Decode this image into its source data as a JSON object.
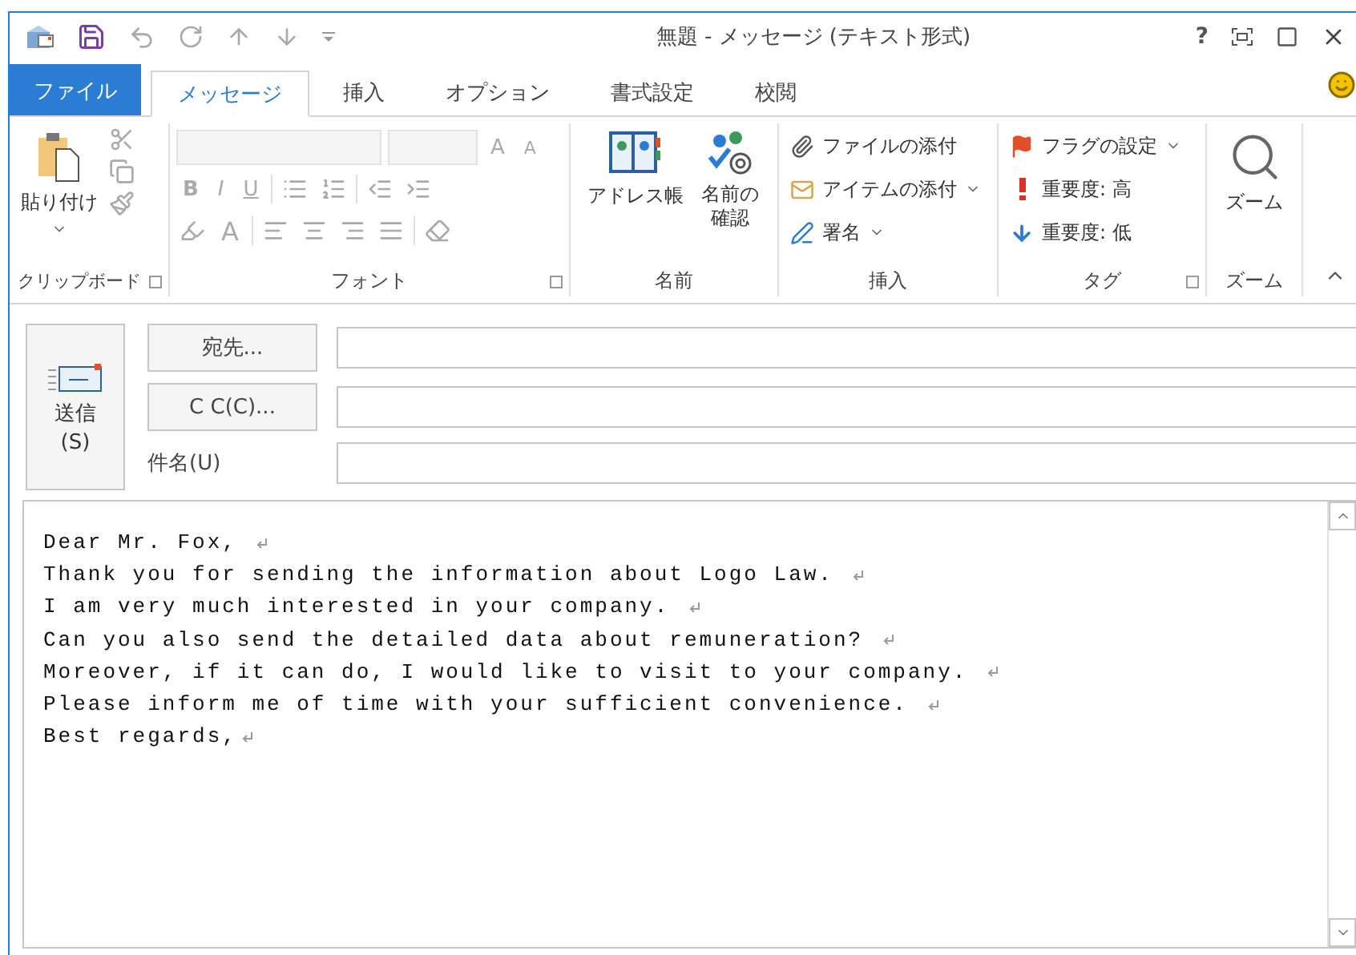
{
  "window": {
    "title": "無題 - メッセージ (テキスト形式)",
    "help": "?"
  },
  "tabs": [
    {
      "label": "ファイル",
      "kind": "file",
      "selected": false
    },
    {
      "label": "メッセージ",
      "kind": "tab",
      "selected": true
    },
    {
      "label": "挿入",
      "kind": "tab",
      "selected": false
    },
    {
      "label": "オプション",
      "kind": "tab",
      "selected": false
    },
    {
      "label": "書式設定",
      "kind": "tab",
      "selected": false
    },
    {
      "label": "校閲",
      "kind": "tab",
      "selected": false
    }
  ],
  "ribbon": {
    "clipboard": {
      "label": "クリップボード",
      "paste": "貼り付け"
    },
    "font": {
      "label": "フォント",
      "disabled": true,
      "bold": "B",
      "italic": "I",
      "underline": "U",
      "grow": "A",
      "shrink": "A",
      "font_color": "A"
    },
    "names": {
      "label": "名前",
      "items": [
        "アドレス帳",
        "名前の確認"
      ]
    },
    "insert": {
      "label": "挿入",
      "items": [
        {
          "label": "ファイルの添付",
          "kind": "file",
          "dropdown": false
        },
        {
          "label": "アイテムの添付",
          "kind": "item",
          "dropdown": true
        },
        {
          "label": "署名",
          "kind": "signature",
          "dropdown": true
        }
      ]
    },
    "tags": {
      "label": "タグ",
      "items": [
        {
          "label": "フラグの設定",
          "kind": "flag",
          "dropdown": true
        },
        {
          "label": "重要度: 高",
          "kind": "high",
          "dropdown": false
        },
        {
          "label": "重要度: 低",
          "kind": "low",
          "dropdown": false
        }
      ]
    },
    "zoom": {
      "label": "ズーム",
      "button": "ズーム"
    }
  },
  "header": {
    "send": {
      "label": "送信",
      "accesskey": "(S)"
    },
    "to_button": "宛先...",
    "cc_button": "C C(C)...",
    "subject_label": "件名(U)"
  },
  "body": {
    "lines": [
      "Dear Mr. Fox, ",
      "Thank you for sending the information about Logo Law. ",
      "I am very much interested in your company. ",
      "Can you also send the detailed data about remuneration? ",
      "Moreover, if it can do, I would like to visit to your company. ",
      "Please inform me of time with your sufficient convenience. ",
      "Best regards,"
    ]
  }
}
